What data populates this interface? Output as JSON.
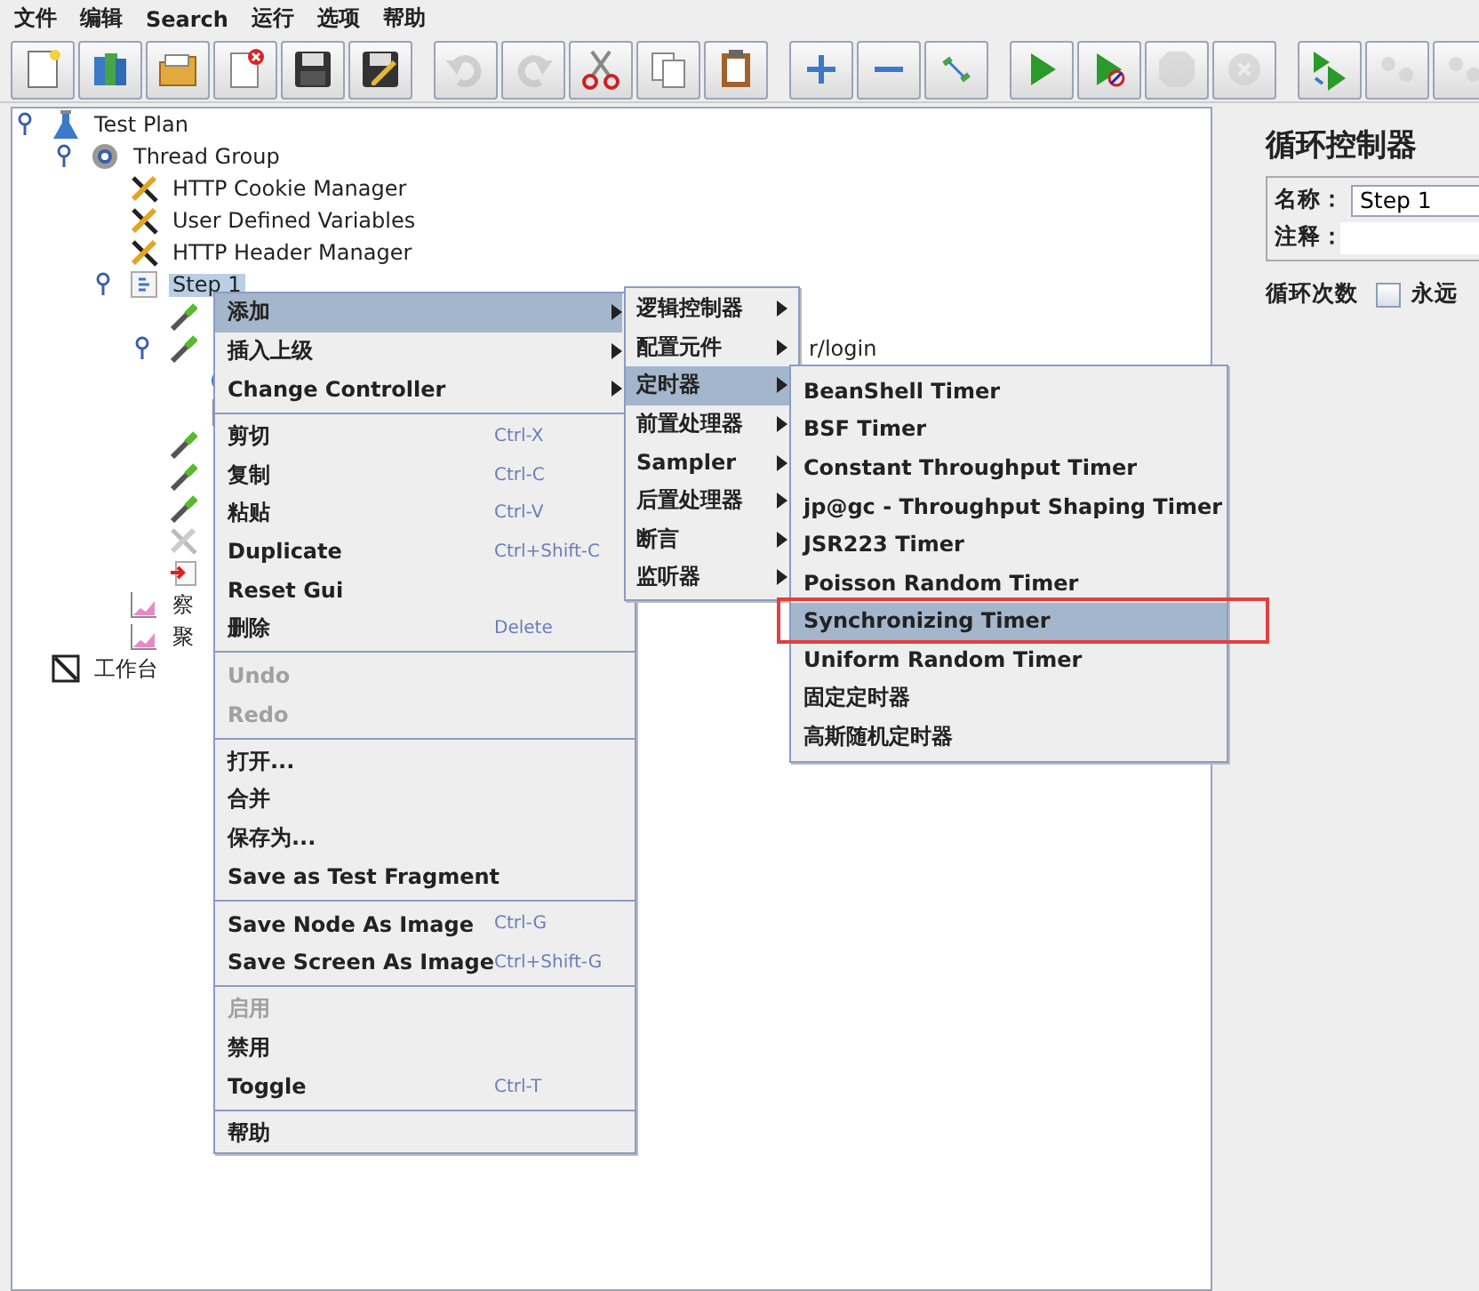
{
  "menu_bar": [
    "文件",
    "编辑",
    "Search",
    "运行",
    "选项",
    "帮助"
  ],
  "toolbar": [
    [
      {
        "kind": "new",
        "disabled": false
      },
      {
        "kind": "templates",
        "disabled": false
      },
      {
        "kind": "open",
        "disabled": false
      },
      {
        "kind": "close",
        "disabled": false
      },
      {
        "kind": "save",
        "disabled": false
      },
      {
        "kind": "save-as",
        "disabled": false
      }
    ],
    [
      {
        "kind": "undo",
        "disabled": true
      },
      {
        "kind": "redo",
        "disabled": true
      },
      {
        "kind": "cut",
        "disabled": false
      },
      {
        "kind": "copy",
        "disabled": false
      },
      {
        "kind": "paste",
        "disabled": false
      }
    ],
    [
      {
        "kind": "expand",
        "disabled": false
      },
      {
        "kind": "collapse",
        "disabled": false
      },
      {
        "kind": "toggle",
        "disabled": false
      }
    ],
    [
      {
        "kind": "start",
        "disabled": false
      },
      {
        "kind": "start-no-timers",
        "disabled": false
      },
      {
        "kind": "stop",
        "disabled": true
      },
      {
        "kind": "shutdown",
        "disabled": true
      }
    ],
    [
      {
        "kind": "remote-start",
        "disabled": false
      },
      {
        "kind": "remote-stop",
        "disabled": true
      },
      {
        "kind": "remote-stop",
        "disabled": true
      }
    ]
  ],
  "tree": [
    {
      "label": "Test Plan",
      "kind": "flask",
      "expanded": true,
      "selected": false,
      "children": [
        {
          "label": "Thread Group",
          "kind": "gear",
          "expanded": true,
          "selected": false,
          "children": [
            {
              "label": "HTTP Cookie Manager",
              "kind": "wrench",
              "selected": false
            },
            {
              "label": "User Defined Variables",
              "kind": "wrench",
              "selected": false
            },
            {
              "label": "HTTP Header Manager",
              "kind": "wrench",
              "selected": false
            },
            {
              "label": "Step 1",
              "kind": "controller",
              "expanded": true,
              "selected": true,
              "children": [
                {
                  "kind": "dropper"
                },
                {
                  "label": "r/login",
                  "kind": "dropper",
                  "expanded": true,
                  "children": [
                    {
                      "kind": "timer"
                    },
                    {
                      "kind": "doc"
                    }
                  ]
                },
                {
                  "kind": "dropper"
                },
                {
                  "kind": "dropper"
                },
                {
                  "kind": "dropper"
                },
                {
                  "kind": "wrench-disabled"
                },
                {
                  "kind": "doc-arrow"
                }
              ]
            },
            {
              "label": "察",
              "kind": "graph",
              "selected": false
            },
            {
              "label": "聚",
              "kind": "graph",
              "selected": false
            }
          ]
        }
      ]
    },
    {
      "label": "工作台",
      "kind": "workbench",
      "selected": false
    }
  ],
  "context_menu": [
    [
      {
        "label": "添加",
        "submenu": true,
        "selected": true,
        "disabled": false
      },
      {
        "label": "插入上级",
        "submenu": true,
        "selected": false,
        "disabled": false
      },
      {
        "label": "Change Controller",
        "submenu": true,
        "selected": false,
        "disabled": false
      }
    ],
    [
      {
        "label": "剪切",
        "shortcut": "Ctrl-X",
        "selected": false,
        "disabled": false
      },
      {
        "label": "复制",
        "shortcut": "Ctrl-C",
        "selected": false,
        "disabled": false
      },
      {
        "label": "粘贴",
        "shortcut": "Ctrl-V",
        "selected": false,
        "disabled": false
      },
      {
        "label": "Duplicate",
        "shortcut": "Ctrl+Shift-C",
        "selected": false,
        "disabled": false
      },
      {
        "label": "Reset Gui",
        "selected": false,
        "disabled": false
      },
      {
        "label": "删除",
        "shortcut": "Delete",
        "selected": false,
        "disabled": false
      }
    ],
    [
      {
        "label": "Undo",
        "selected": false,
        "disabled": true
      },
      {
        "label": "Redo",
        "selected": false,
        "disabled": true
      }
    ],
    [
      {
        "label": "打开...",
        "selected": false,
        "disabled": false
      },
      {
        "label": "合并",
        "selected": false,
        "disabled": false
      },
      {
        "label": "保存为...",
        "selected": false,
        "disabled": false
      },
      {
        "label": "Save as Test Fragment",
        "selected": false,
        "disabled": false
      }
    ],
    [
      {
        "label": "Save Node As Image",
        "shortcut": "Ctrl-G",
        "selected": false,
        "disabled": false
      },
      {
        "label": "Save Screen As Image",
        "shortcut": "Ctrl+Shift-G",
        "selected": false,
        "disabled": false
      }
    ],
    [
      {
        "label": "启用",
        "selected": false,
        "disabled": true
      },
      {
        "label": "禁用",
        "selected": false,
        "disabled": false
      },
      {
        "label": "Toggle",
        "shortcut": "Ctrl-T",
        "selected": false,
        "disabled": false
      }
    ],
    [
      {
        "label": "帮助",
        "selected": false,
        "disabled": false
      }
    ]
  ],
  "add_submenu": [
    {
      "label": "逻辑控制器",
      "selected": false
    },
    {
      "label": "配置元件",
      "selected": false
    },
    {
      "label": "定时器",
      "selected": true
    },
    {
      "label": "前置处理器",
      "selected": false
    },
    {
      "label": "Sampler",
      "selected": false
    },
    {
      "label": "后置处理器",
      "selected": false
    },
    {
      "label": "断言",
      "selected": false
    },
    {
      "label": "监听器",
      "selected": false
    }
  ],
  "timer_submenu": [
    {
      "label": "BeanShell Timer",
      "selected": false,
      "marked": false
    },
    {
      "label": "BSF Timer",
      "selected": false,
      "marked": false
    },
    {
      "label": "Constant Throughput Timer",
      "selected": false,
      "marked": false
    },
    {
      "label": "jp@gc - Throughput Shaping Timer",
      "selected": false,
      "marked": false
    },
    {
      "label": "JSR223 Timer",
      "selected": false,
      "marked": false
    },
    {
      "label": "Poisson Random Timer",
      "selected": false,
      "marked": false
    },
    {
      "label": "Synchronizing Timer",
      "selected": true,
      "marked": true
    },
    {
      "label": "Uniform Random Timer",
      "selected": false,
      "marked": false
    },
    {
      "label": "固定定时器",
      "selected": false,
      "marked": false
    },
    {
      "label": "高斯随机定时器",
      "selected": false,
      "marked": false
    }
  ],
  "panel": {
    "title": "循环控制器",
    "name_label": "名称：",
    "name_value": "Step 1",
    "comment_label": "注释：",
    "loop_label": "循环次数",
    "forever": {
      "label": "永远",
      "checked": false
    }
  }
}
